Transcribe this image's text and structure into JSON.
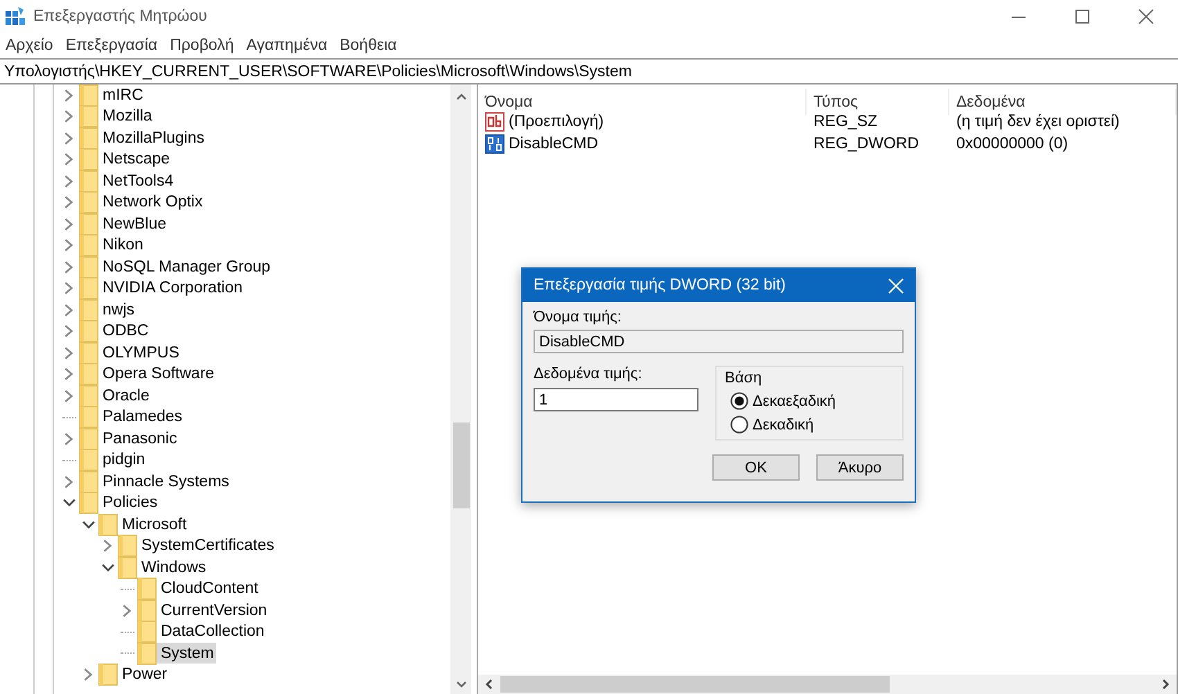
{
  "window": {
    "title": "Επεξεργαστής Μητρώου"
  },
  "menu": [
    "Αρχείο",
    "Επεξεργασία",
    "Προβολή",
    "Αγαπημένα",
    "Βοήθεια"
  ],
  "address": "Υπολογιστής\\HKEY_CURRENT_USER\\SOFTWARE\\Policies\\Microsoft\\Windows\\System",
  "tree": {
    "items": [
      {
        "label": "mIRC",
        "expandable": true,
        "expanded": false,
        "selected": false
      },
      {
        "label": "Mozilla",
        "expandable": true,
        "expanded": false,
        "selected": false
      },
      {
        "label": "MozillaPlugins",
        "expandable": true,
        "expanded": false,
        "selected": false
      },
      {
        "label": "Netscape",
        "expandable": true,
        "expanded": false,
        "selected": false
      },
      {
        "label": "NetTools4",
        "expandable": true,
        "expanded": false,
        "selected": false
      },
      {
        "label": "Network Optix",
        "expandable": true,
        "expanded": false,
        "selected": false
      },
      {
        "label": "NewBlue",
        "expandable": true,
        "expanded": false,
        "selected": false
      },
      {
        "label": "Nikon",
        "expandable": true,
        "expanded": false,
        "selected": false
      },
      {
        "label": "NoSQL Manager Group",
        "expandable": true,
        "expanded": false,
        "selected": false
      },
      {
        "label": "NVIDIA Corporation",
        "expandable": true,
        "expanded": false,
        "selected": false
      },
      {
        "label": "nwjs",
        "expandable": true,
        "expanded": false,
        "selected": false
      },
      {
        "label": "ODBC",
        "expandable": true,
        "expanded": false,
        "selected": false
      },
      {
        "label": "OLYMPUS",
        "expandable": true,
        "expanded": false,
        "selected": false
      },
      {
        "label": "Opera Software",
        "expandable": true,
        "expanded": false,
        "selected": false
      },
      {
        "label": "Oracle",
        "expandable": true,
        "expanded": false,
        "selected": false
      },
      {
        "label": "Palamedes",
        "expandable": false,
        "selected": false
      },
      {
        "label": "Panasonic",
        "expandable": true,
        "expanded": false,
        "selected": false
      },
      {
        "label": "pidgin",
        "expandable": false,
        "selected": false
      },
      {
        "label": "Pinnacle Systems",
        "expandable": true,
        "expanded": false,
        "selected": false
      },
      {
        "label": "Policies",
        "expandable": true,
        "expanded": true,
        "selected": false,
        "children": [
          {
            "label": "Microsoft",
            "expandable": true,
            "expanded": true,
            "selected": false,
            "children": [
              {
                "label": "SystemCertificates",
                "expandable": true,
                "expanded": false,
                "selected": false
              },
              {
                "label": "Windows",
                "expandable": true,
                "expanded": true,
                "selected": false,
                "children": [
                  {
                    "label": "CloudContent",
                    "expandable": false,
                    "selected": false
                  },
                  {
                    "label": "CurrentVersion",
                    "expandable": true,
                    "expanded": false,
                    "selected": false
                  },
                  {
                    "label": "DataCollection",
                    "expandable": false,
                    "selected": false
                  },
                  {
                    "label": "System",
                    "expandable": false,
                    "selected": true
                  }
                ]
              }
            ]
          },
          {
            "label": "Power",
            "expandable": true,
            "expanded": false,
            "selected": false
          }
        ]
      }
    ]
  },
  "values": {
    "columns": [
      "Όνομα",
      "Τύπος",
      "Δεδομένα"
    ],
    "rows": [
      {
        "kind": "string",
        "name": "(Προεπιλογή)",
        "type": "REG_SZ",
        "data": "(η τιμή δεν έχει οριστεί)"
      },
      {
        "kind": "binary",
        "name": "DisableCMD",
        "type": "REG_DWORD",
        "data": "0x00000000 (0)"
      }
    ]
  },
  "dialog": {
    "title": "Επεξεργασία τιμής DWORD (32 bit)",
    "name_label": "Όνομα τιμής:",
    "name_value": "DisableCMD",
    "data_label": "Δεδομένα τιμής:",
    "data_value": "1",
    "base": {
      "label": "Βάση",
      "options": [
        {
          "label": "Δεκαεξαδική",
          "selected": true
        },
        {
          "label": "Δεκαδική",
          "selected": false
        }
      ]
    },
    "buttons": [
      "OK",
      "Άκυρο"
    ]
  }
}
